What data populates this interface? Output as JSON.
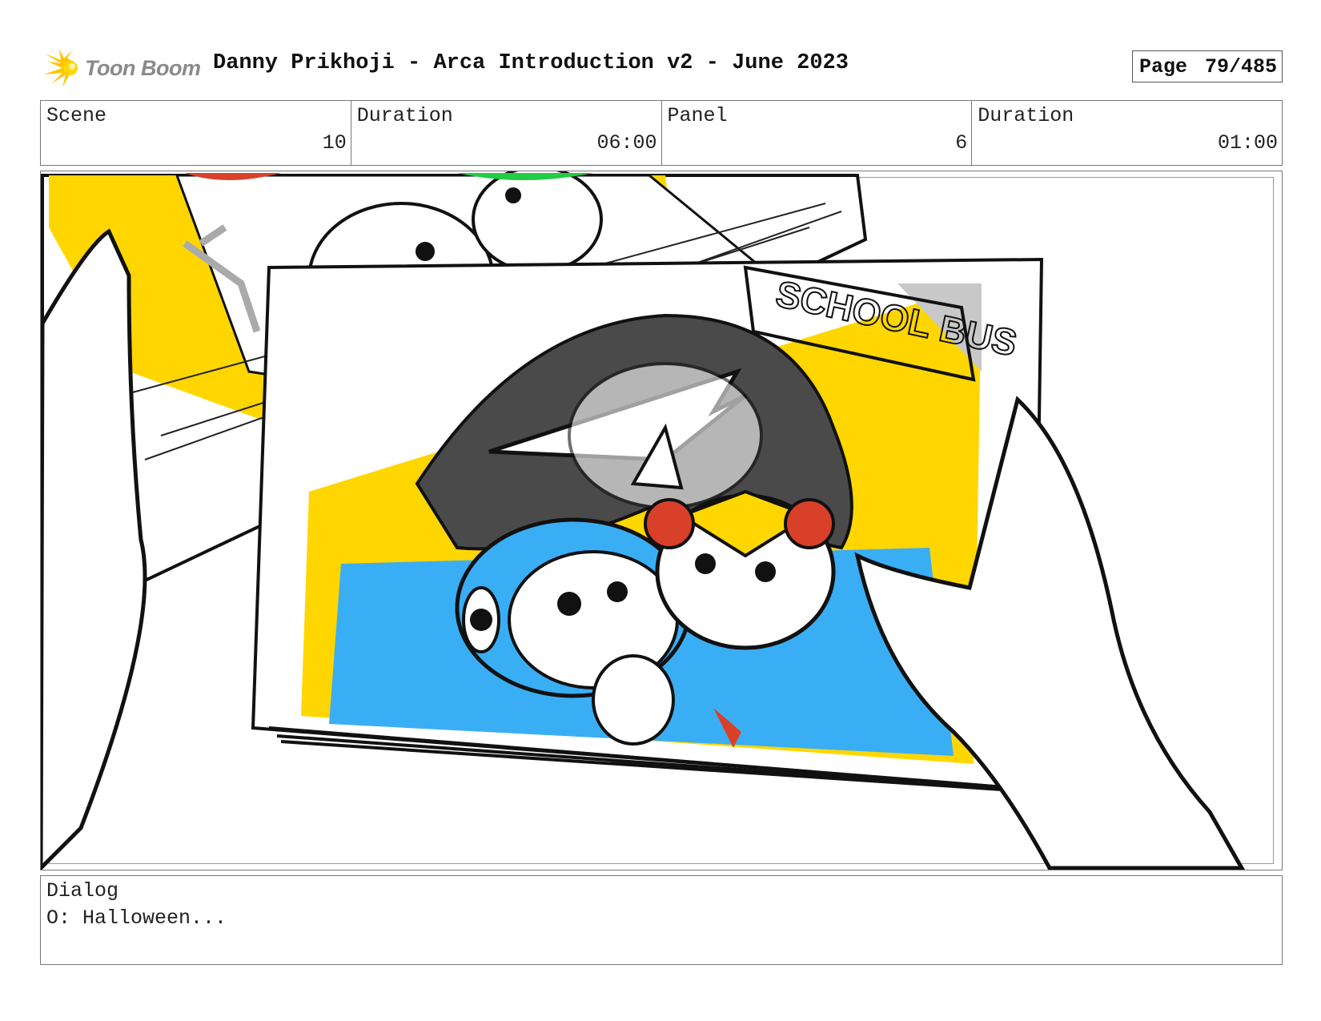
{
  "header": {
    "logo_text": "Toon Boom",
    "title": "Danny Prikhoji - Arca Introduction v2 - June 2023",
    "page_label": "Page",
    "page_value": "79/485"
  },
  "info": [
    {
      "label": "Scene",
      "value": "10"
    },
    {
      "label": "Duration",
      "value": "06:00"
    },
    {
      "label": "Panel",
      "value": "6"
    },
    {
      "label": "Duration",
      "value": "01:00"
    }
  ],
  "panel": {
    "sign_text": "SCHOOL BUS",
    "colors": {
      "yellow": "#ffd600",
      "blue": "#3aaef5",
      "dark": "#4a4a4a",
      "red": "#d9402a",
      "green": "#22cc44"
    }
  },
  "dialog": {
    "label": "Dialog",
    "text": "O: Halloween..."
  }
}
